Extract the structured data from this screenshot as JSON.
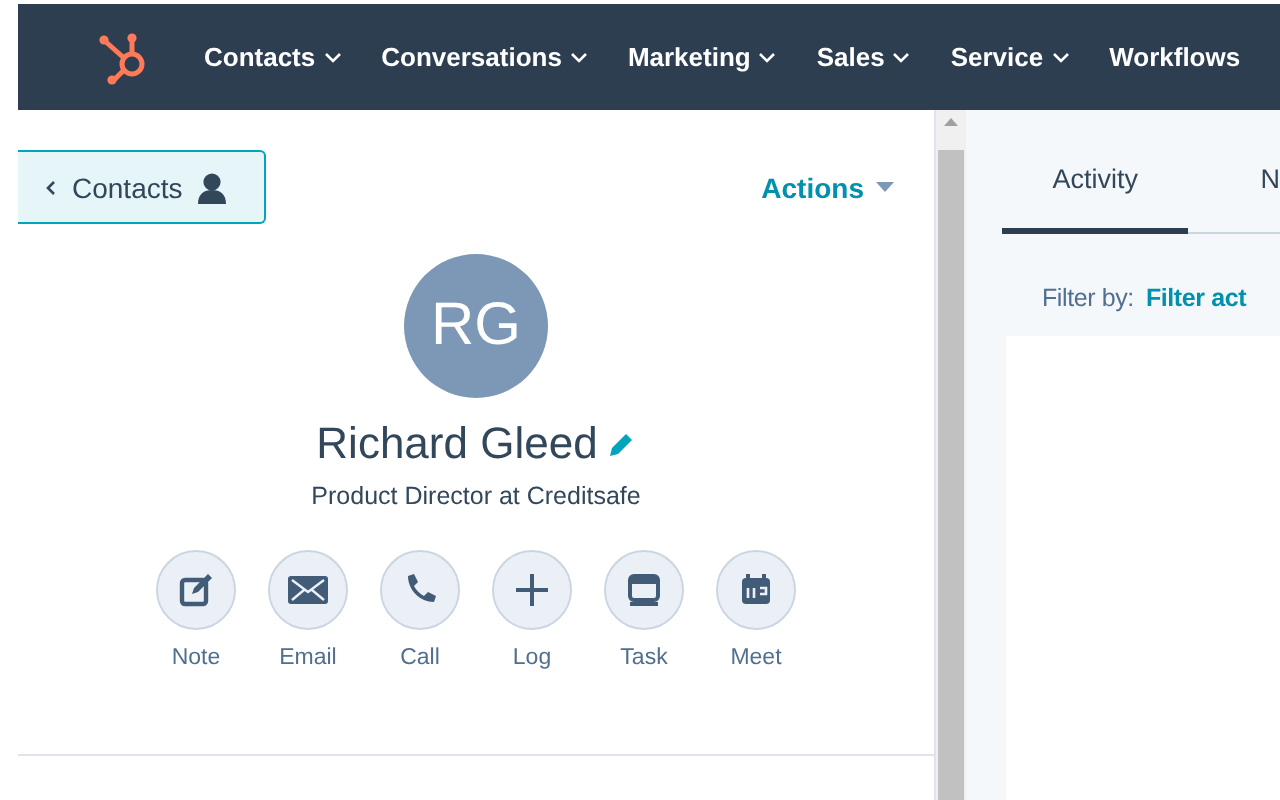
{
  "nav": {
    "items": [
      {
        "label": "Contacts",
        "dropdown": true
      },
      {
        "label": "Conversations",
        "dropdown": true
      },
      {
        "label": "Marketing",
        "dropdown": true
      },
      {
        "label": "Sales",
        "dropdown": true
      },
      {
        "label": "Service",
        "dropdown": true
      },
      {
        "label": "Workflows",
        "dropdown": false
      }
    ]
  },
  "contact": {
    "back_label": "Contacts",
    "actions_label": "Actions",
    "initials": "RG",
    "name": "Richard Gleed",
    "subtitle": "Product Director at Creditsafe",
    "quick_actions": [
      {
        "kind": "note",
        "label": "Note"
      },
      {
        "kind": "email",
        "label": "Email"
      },
      {
        "kind": "call",
        "label": "Call"
      },
      {
        "kind": "log",
        "label": "Log"
      },
      {
        "kind": "task",
        "label": "Task"
      },
      {
        "kind": "meet",
        "label": "Meet"
      }
    ]
  },
  "activity": {
    "tabs": [
      {
        "label": "Activity",
        "selected": true
      },
      {
        "label": "N",
        "selected": false
      }
    ],
    "filter_label": "Filter by:",
    "filter_link": "Filter act"
  }
}
